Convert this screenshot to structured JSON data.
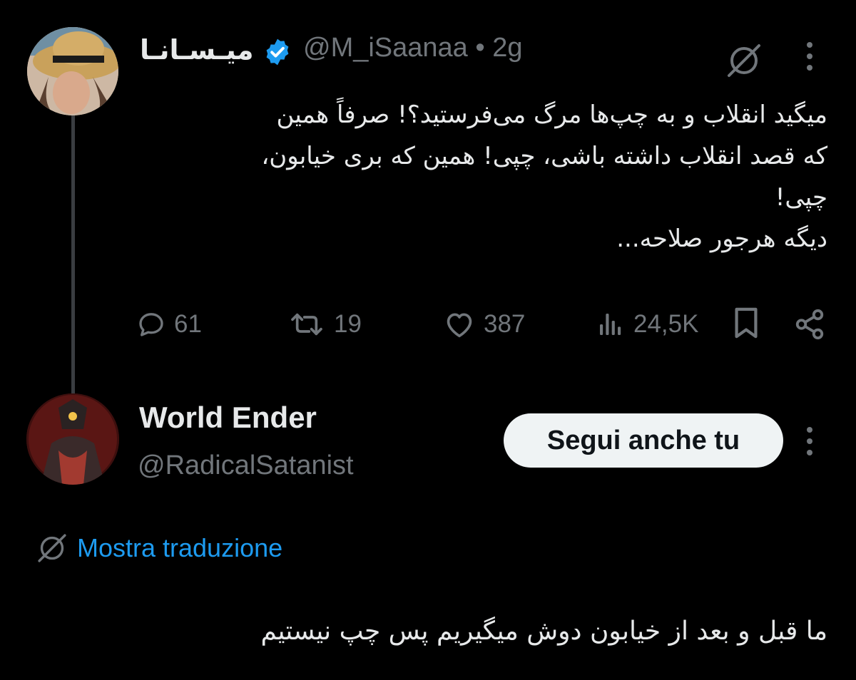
{
  "tweet": {
    "author_name": "میـسـانـا",
    "handle_time": "@M_iSaanaa • 2g",
    "text": "میگید انقلاب و به چپ‌ها مرگ می‌فرستید؟!  صرفاً همین\nکه قصد انقلاب داشته باشی، چپی! همین که بری خیابون،\nچپی!\nدیگه هرجور صلاحه...",
    "stats": {
      "replies": "61",
      "retweets": "19",
      "likes": "387",
      "views": "24,5K"
    }
  },
  "reply": {
    "author_name": "World Ender",
    "handle": "@RadicalSatanist",
    "follow_label": "Segui anche tu",
    "translate_label": "Mostra traduzione",
    "text": "ما قبل و بعد از خیابون دوش میگیریم پس چپ نیستیم"
  },
  "colors": {
    "background": "#000000",
    "text": "#e7e9ea",
    "muted": "#71767b",
    "link": "#1d9bf0",
    "verified": "#1d9bf0"
  },
  "icons": [
    "verified-badge-icon",
    "grok-icon",
    "more-icon",
    "reply-icon",
    "retweet-icon",
    "like-icon",
    "views-icon",
    "bookmark-icon",
    "share-icon"
  ]
}
